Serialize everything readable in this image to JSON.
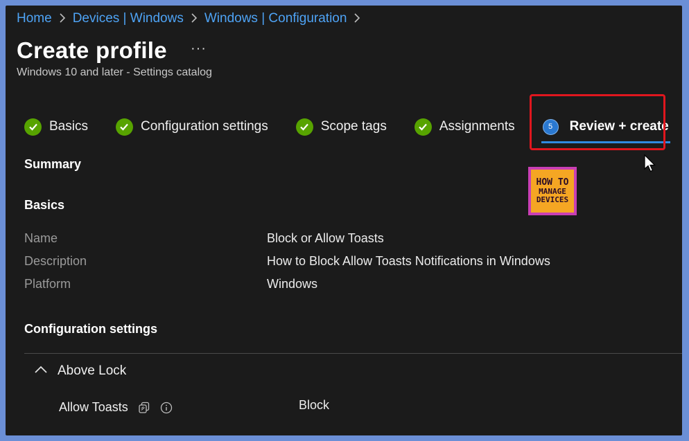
{
  "breadcrumb": {
    "items": [
      "Home",
      "Devices | Windows",
      "Windows | Configuration"
    ]
  },
  "header": {
    "title": "Create profile",
    "more": "···",
    "subtitle": "Windows 10 and later - Settings catalog"
  },
  "wizard": {
    "steps": [
      {
        "label": "Basics",
        "state": "complete"
      },
      {
        "label": "Configuration settings",
        "state": "complete"
      },
      {
        "label": "Scope tags",
        "state": "complete"
      },
      {
        "label": "Assignments",
        "state": "complete"
      },
      {
        "label": "Review + create",
        "state": "active",
        "number": "5"
      }
    ]
  },
  "logo": {
    "line1": "HOW TO",
    "line2": "MANAGE",
    "line3": "DEVICES"
  },
  "summary": {
    "heading": "Summary",
    "basics_heading": "Basics",
    "properties": [
      {
        "label": "Name",
        "value": "Block or Allow Toasts"
      },
      {
        "label": "Description",
        "value": "How to Block Allow Toasts Notifications in Windows"
      },
      {
        "label": "Platform",
        "value": "Windows"
      }
    ],
    "config_heading": "Configuration settings",
    "group": {
      "label": "Above Lock",
      "expanded": true
    },
    "setting": {
      "label": "Allow Toasts",
      "value": "Block"
    }
  },
  "colors": {
    "accent": "#2f8ae0",
    "check": "#57a300",
    "highlight": "#e0161e",
    "link": "#4ea3f5"
  },
  "icons": [
    "chevron-right-icon",
    "checkmark-icon",
    "chevron-up-icon",
    "copy-icon",
    "info-icon",
    "mouse-cursor-icon"
  ]
}
